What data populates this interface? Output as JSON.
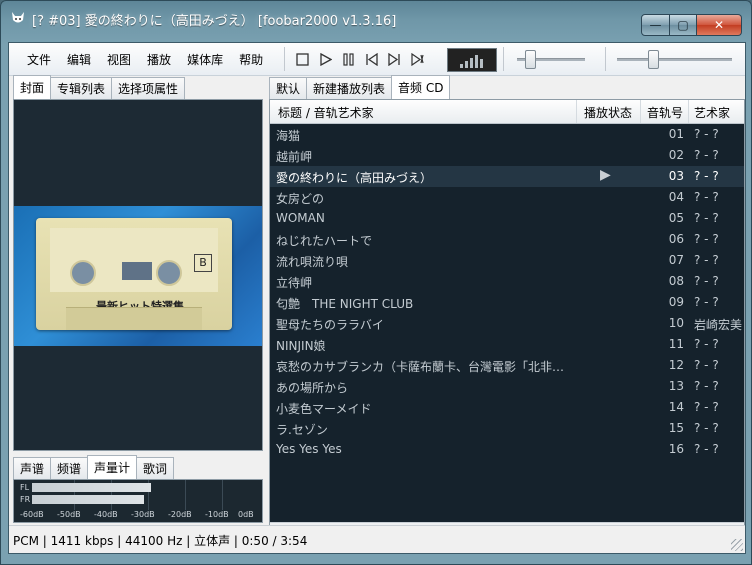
{
  "window": {
    "title": "[? #03] 愛の終わりに（高田みづえ） [foobar2000 v1.3.16]",
    "caption": {
      "min": "—",
      "max": "▢",
      "close": "✕"
    }
  },
  "menu": [
    "文件",
    "编辑",
    "视图",
    "播放",
    "媒体库",
    "帮助"
  ],
  "toolbar": {
    "buttons": [
      "stop-icon",
      "play-icon",
      "pause-icon",
      "prev-icon",
      "next-icon",
      "random-icon"
    ],
    "seek_position": 0.12,
    "volume_position": 0.27
  },
  "left_tabs": [
    "封面",
    "专辑列表",
    "选择项属性"
  ],
  "cover": {
    "label_letter": "B",
    "label_text": "最新ヒット特選集"
  },
  "bottom_tabs": [
    "声谱",
    "频谱",
    "声量计",
    "歌词"
  ],
  "meter": {
    "channels": [
      "FL",
      "FR"
    ],
    "levels": [
      0.56,
      0.53
    ],
    "scale": [
      "-60dB",
      "-50dB",
      "-40dB",
      "-30dB",
      "-20dB",
      "-10dB",
      "0dB"
    ]
  },
  "right_tabs": [
    "默认",
    "新建播放列表",
    "音频 CD"
  ],
  "playlist": {
    "columns": {
      "title": "标题 / 音轨艺术家",
      "status": "播放状态",
      "track": "音轨号",
      "artist": "艺术家"
    },
    "playing_index": 2,
    "playing_glyph": "▶",
    "rows": [
      {
        "title": "海猫",
        "track": "01",
        "artist": "? - ?"
      },
      {
        "title": "越前岬",
        "track": "02",
        "artist": "? - ?"
      },
      {
        "title": "愛の終わりに（高田みづえ）",
        "track": "03",
        "artist": "? - ?"
      },
      {
        "title": "女房どの",
        "track": "04",
        "artist": "? - ?"
      },
      {
        "title": "WOMAN",
        "track": "05",
        "artist": "? - ?"
      },
      {
        "title": "ねじれたハートで",
        "track": "06",
        "artist": "? - ?"
      },
      {
        "title": "流れ唄流り唄",
        "track": "07",
        "artist": "? - ?"
      },
      {
        "title": "立待岬",
        "track": "08",
        "artist": "? - ?"
      },
      {
        "title": "匂艶　THE NIGHT CLUB",
        "track": "09",
        "artist": "? - ?"
      },
      {
        "title": "聖母たちのララバイ",
        "track": "10",
        "artist": "岩崎宏美"
      },
      {
        "title": "NINJIN娘",
        "track": "11",
        "artist": "? - ?"
      },
      {
        "title": "哀愁のカサブランカ（卡薩布蘭卡、台灣電影「北非…",
        "track": "12",
        "artist": "? - ?"
      },
      {
        "title": "あの場所から",
        "track": "13",
        "artist": "? - ?"
      },
      {
        "title": "小麦色マーメイド",
        "track": "14",
        "artist": "? - ?"
      },
      {
        "title": "ラ.セゾン",
        "track": "15",
        "artist": "? - ?"
      },
      {
        "title": "Yes Yes Yes",
        "track": "16",
        "artist": "? - ?"
      }
    ]
  },
  "status_bar": "PCM | 1411 kbps | 44100 Hz | 立体声 | 0:50 / 3:54"
}
